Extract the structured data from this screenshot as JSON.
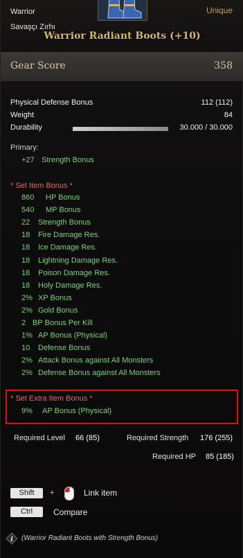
{
  "header": {
    "class": "Warrior",
    "subname": "Savaşçı Zırhı",
    "rarity": "Unique",
    "item_name": "Warrior Radiant Boots (+10)",
    "item_icon": "boots-icon"
  },
  "gear_score": {
    "label": "Gear Score",
    "value": "358"
  },
  "stats": [
    {
      "label": "Physical Defense Bonus",
      "value": "112 (112)"
    },
    {
      "label": "Weight",
      "value": "84"
    },
    {
      "label": "Durability",
      "value": "30.000 / 30.000",
      "fill": 1.0
    }
  ],
  "primary": {
    "title": "Primary:",
    "amount": "+27",
    "label": "Strength Bonus"
  },
  "set_item": {
    "title": "* Set Item  Bonus *",
    "bonuses": [
      {
        "amount": "860",
        "label": "HP Bonus"
      },
      {
        "amount": "540",
        "label": "MP Bonus"
      },
      {
        "amount": "22",
        "label": "Strength Bonus"
      },
      {
        "amount": "18",
        "label": "Fire Damage Res."
      },
      {
        "amount": "18",
        "label": "Ice Damage Res."
      },
      {
        "amount": "18",
        "label": "Lightning Damage Res."
      },
      {
        "amount": "18",
        "label": "Poison Damage Res."
      },
      {
        "amount": "18",
        "label": "Holy Damage Res."
      },
      {
        "amount": "2%",
        "label": "XP Bonus"
      },
      {
        "amount": "2%",
        "label": "Gold Bonus"
      },
      {
        "amount": "2",
        "label": "BP Bonus Per Kill"
      },
      {
        "amount": "1%",
        "label": "AP Bonus (Physical)"
      },
      {
        "amount": "10",
        "label": "Defense Bonus"
      },
      {
        "amount": "2%",
        "label": "Attack Bonus against All Monsters"
      },
      {
        "amount": "2%",
        "label": "Defense Bonus against All Monsters"
      }
    ]
  },
  "set_extra": {
    "title": "* Set Extra Item Bonus *",
    "amount": "9%",
    "label": "AP Bonus (Physical)"
  },
  "requirements": {
    "level_label": "Required Level",
    "level_value": "66 (85)",
    "strength_label": "Required Strength",
    "strength_value": "176 (255)",
    "hp_label": "Required HP",
    "hp_value": "85 (185)"
  },
  "hints": {
    "shift_key": "Shift",
    "plus": "+",
    "link_label": "Link item",
    "ctrl_key": "Ctrl",
    "compare_label": "Compare"
  },
  "footnote": "(Warrior Radiant Boots with Strength Bonus)",
  "colors": {
    "bonus_green": "#7fd07b",
    "set_title_red": "#e06a5e",
    "rarity_gold": "#c9a04a",
    "highlight_box": "#e0101a"
  }
}
